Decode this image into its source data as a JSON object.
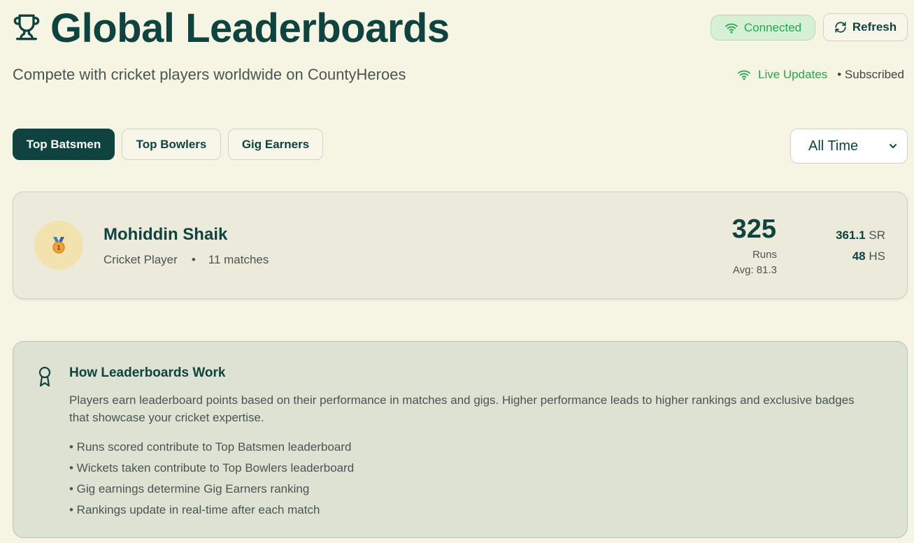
{
  "header": {
    "title": "Global Leaderboards",
    "subtitle": "Compete with cricket players worldwide on CountyHeroes",
    "icon": "trophy-icon"
  },
  "status": {
    "connected_label": "Connected",
    "refresh_label": "Refresh",
    "live_label": "Live Updates",
    "subscribed_label": "• Subscribed",
    "accent_color": "#22a94b"
  },
  "tabs": [
    {
      "label": "Top Batsmen",
      "active": true
    },
    {
      "label": "Top Bowlers",
      "active": false
    },
    {
      "label": "Gig Earners",
      "active": false
    }
  ],
  "period_select": {
    "selected": "All Time"
  },
  "leaderboard": {
    "entries": [
      {
        "rank": "1",
        "rank_icon": "medal-icon",
        "name": "Mohiddin Shaik",
        "role": "Cricket Player",
        "separator": "•",
        "matches": "11 matches",
        "primary_value": "325",
        "primary_label": "Runs",
        "average": "Avg: 81.3",
        "strike_rate_value": "361.1",
        "strike_rate_label": "SR",
        "highest_score_value": "48",
        "highest_score_label": "HS"
      }
    ]
  },
  "info": {
    "icon": "award-icon",
    "title": "How Leaderboards Work",
    "body": "Players earn leaderboard points based on their performance in matches and gigs. Higher performance leads to higher rankings and exclusive badges that showcase your cricket expertise.",
    "bullets": [
      "• Runs scored contribute to Top Batsmen leaderboard",
      "• Wickets taken contribute to Top Bowlers leaderboard",
      "• Gig earnings determine Gig Earners ranking",
      "• Rankings update in real-time after each match"
    ]
  },
  "colors": {
    "background": "#f6f4e3",
    "primary": "#0f4340",
    "card": "#ebeadb",
    "info_card": "#dde2d3"
  }
}
